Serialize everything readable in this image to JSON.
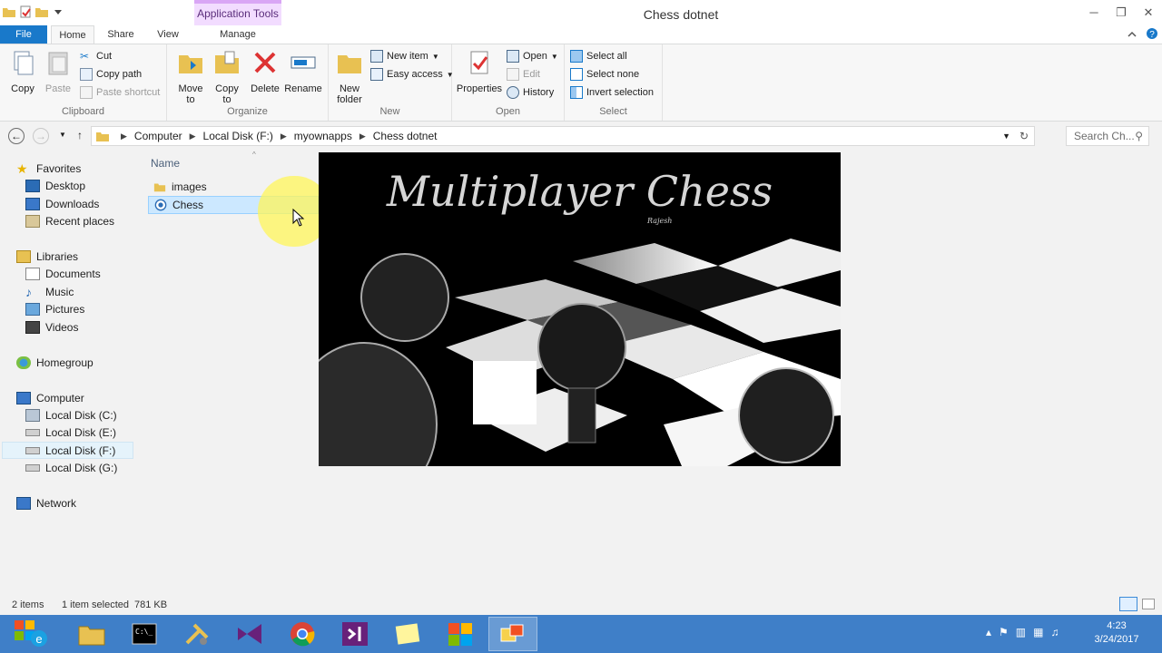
{
  "window": {
    "title": "Chess dotnet",
    "context_tab": "Application Tools",
    "controls": [
      "─",
      "❐",
      "✕"
    ]
  },
  "tabs": [
    "File",
    "Home",
    "Share",
    "View",
    "Manage"
  ],
  "ribbon": {
    "clipboard": {
      "name": "Clipboard",
      "copy": "Copy",
      "paste": "Paste",
      "cut": "Cut",
      "copy_path": "Copy path",
      "paste_shortcut": "Paste shortcut"
    },
    "organize": {
      "name": "Organize",
      "move_to": "Move to",
      "copy_to": "Copy to",
      "delete": "Delete",
      "rename": "Rename"
    },
    "new": {
      "name": "New",
      "new_folder": "New folder",
      "new_item": "New item",
      "easy_access": "Easy access"
    },
    "open": {
      "name": "Open",
      "properties": "Properties",
      "open": "Open",
      "edit": "Edit",
      "history": "History"
    },
    "select": {
      "name": "Select",
      "select_all": "Select all",
      "select_none": "Select none",
      "invert_selection": "Invert selection"
    }
  },
  "address": {
    "crumbs": [
      "Computer",
      "Local Disk (F:)",
      "myownapps",
      "Chess dotnet"
    ],
    "search_placeholder": "Search Ch..."
  },
  "nav": {
    "favorites": "Favorites",
    "desktop": "Desktop",
    "downloads": "Downloads",
    "recent": "Recent places",
    "libraries": "Libraries",
    "documents": "Documents",
    "music": "Music",
    "pictures": "Pictures",
    "videos": "Videos",
    "homegroup": "Homegroup",
    "computer": "Computer",
    "disk_c": "Local Disk (C:)",
    "disk_e": "Local Disk (E:)",
    "disk_f": "Local Disk (F:)",
    "disk_g": "Local Disk (G:)",
    "network": "Network"
  },
  "files": {
    "column_name": "Name",
    "items": [
      "images",
      "Chess"
    ]
  },
  "preview": {
    "title": "Multiplayer Chess",
    "author": "Rajesh"
  },
  "status": {
    "count": "2 items",
    "selected": "1 item selected",
    "size": "781 KB"
  },
  "clock": {
    "time": "4:23",
    "date": "3/24/2017"
  },
  "colors": {
    "file_tab": "#1979ca",
    "taskbar": "#3f7fc8",
    "selection": "#cce8ff",
    "app_tools": "#f2dcff"
  }
}
